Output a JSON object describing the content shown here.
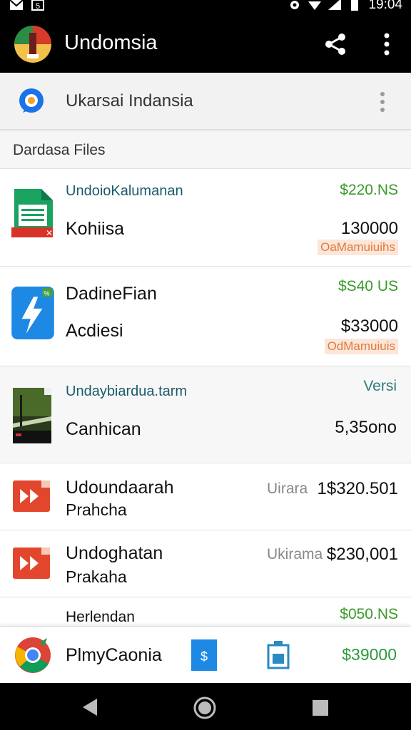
{
  "status_bar": {
    "time": "19:04"
  },
  "app_bar": {
    "title": "Undomsia"
  },
  "sub_bar": {
    "title": "Ukarsai Indansia"
  },
  "section": {
    "header": "Dardasa Files"
  },
  "items": [
    {
      "category": "UndoioKalumanan",
      "name": "Kohiisa",
      "price": "$220.NS",
      "amount": "130000",
      "tag": "OaMamuiuihs"
    },
    {
      "category": "",
      "name1": "DadineFian",
      "name2": "Acdiesi",
      "price": "$S40 US",
      "amount": "$33000",
      "tag": "OdMamuiuis"
    },
    {
      "category": "Undaybiardua.tarm",
      "name": "Canhican",
      "version": "Versi",
      "amount": "5,35ono"
    },
    {
      "name1": "Udoundaarah",
      "name2": "Prahcha",
      "label": "Uirara",
      "amount": "1$320.501"
    },
    {
      "name1": "Undoghatan",
      "name2": "Prakaha",
      "label": "Ukirama",
      "amount": "$230,001"
    },
    {
      "name": "Herlendan",
      "price": "$050.NS"
    }
  ],
  "bottom_bar": {
    "name": "PlmyCaonia",
    "price": "$39000"
  },
  "colors": {
    "app_bar": "#000000",
    "price_green": "#3a9a2a",
    "tag_orange": "#e07a3a",
    "category_teal": "#1a5a6a"
  },
  "icons": [
    "sheet-icon",
    "blue-app-icon",
    "photo-thumbnail",
    "play-icon",
    "chrome-icon",
    "file-icon",
    "battery-icon",
    "back-icon",
    "home-icon",
    "recents-icon",
    "share-icon",
    "more-vert-icon",
    "messenger-icon"
  ]
}
